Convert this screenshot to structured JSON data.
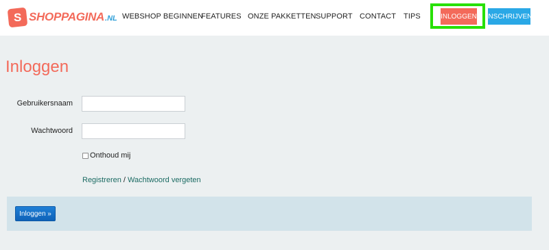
{
  "header": {
    "logo_letter": "S",
    "logo_name": "SHOPPAGINA",
    "logo_tld": ".NL",
    "nav": [
      {
        "label": "WEBSHOP BEGINNEN"
      },
      {
        "label": "FEATURES"
      },
      {
        "label": "ONZE PAKKETTEN"
      },
      {
        "label": "SUPPORT"
      },
      {
        "label": "CONTACT"
      },
      {
        "label": "TIPS"
      }
    ],
    "login_label": "INLOGGEN",
    "signup_label": "INSCHRIJVEN"
  },
  "main": {
    "title": "Inloggen",
    "username_label": "Gebruikersnaam",
    "username_value": "",
    "password_label": "Wachtwoord",
    "password_value": "",
    "remember_label": "Onthoud mij",
    "register_link": "Registreren",
    "link_separator": " / ",
    "forgot_link": "Wachtwoord vergeten",
    "submit_label": "Inloggen »"
  },
  "colors": {
    "brand_red": "#f36a5a",
    "brand_blue": "#2aa8e6",
    "highlight_green": "#27e000",
    "submit_blue": "#0f62b8"
  }
}
